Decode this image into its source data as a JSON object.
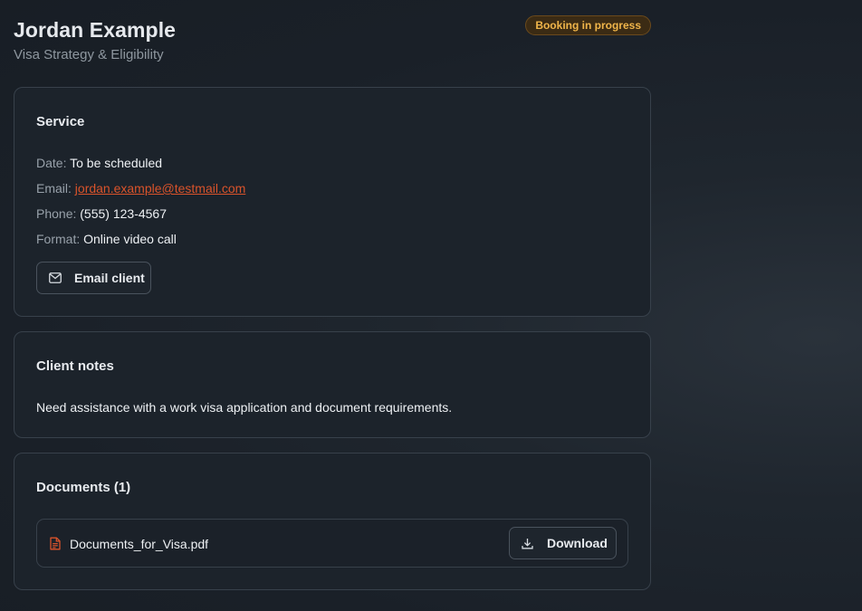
{
  "header": {
    "name": "Jordan Example",
    "service_name": "Visa Strategy & Eligibility",
    "status_badge": "Booking in progress"
  },
  "service_card": {
    "title": "Service",
    "date_label": "Date:",
    "date_value": "To be scheduled",
    "email_label": "Email:",
    "email_value": "jordan.example@testmail.com",
    "phone_label": "Phone:",
    "phone_value": "(555) 123-4567",
    "format_label": "Format:",
    "format_value": "Online video call",
    "email_button_label": "Email client"
  },
  "notes_card": {
    "title": "Client notes",
    "text": "Need assistance with a work visa application and document requirements."
  },
  "documents_card": {
    "title": "Documents (1)",
    "files": [
      {
        "name": "Documents_for_Visa.pdf",
        "download_label": "Download"
      }
    ]
  },
  "colors": {
    "accent_link": "#d9532b",
    "badge_text": "#f0b54a",
    "badge_bg": "#3b2b14"
  },
  "icons": {
    "email_button": "mail-icon",
    "file": "file-text-icon",
    "download": "download-icon"
  }
}
